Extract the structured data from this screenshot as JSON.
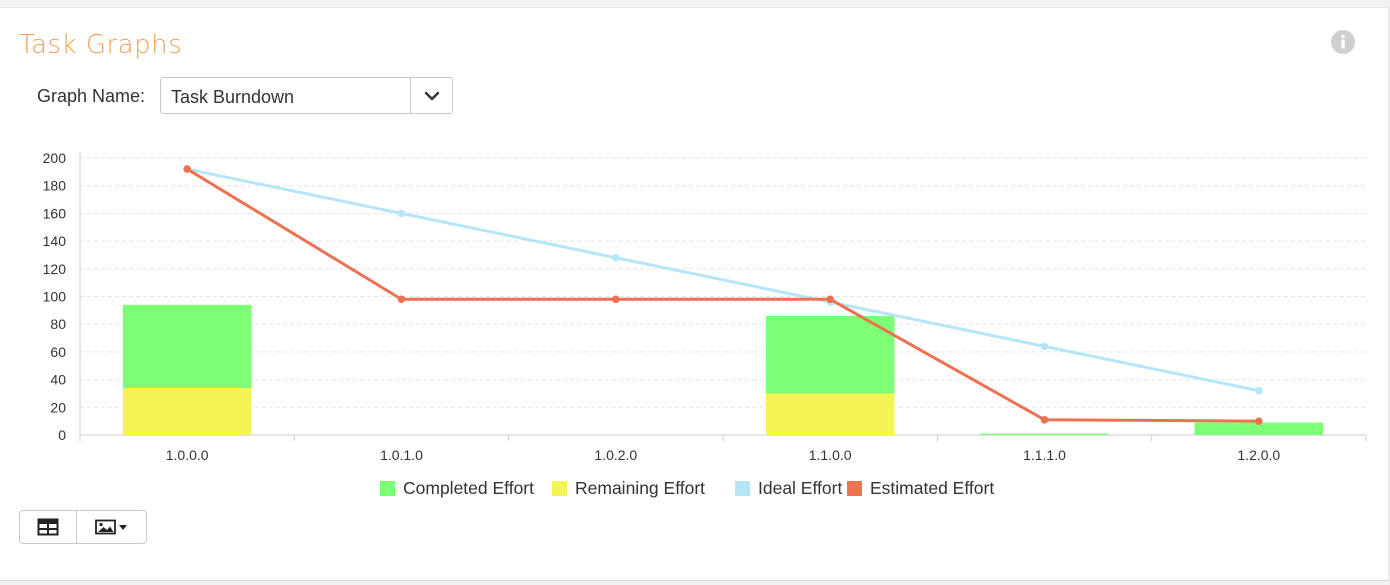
{
  "page": {
    "title": "Task Graphs",
    "graph_name_label": "Graph Name:",
    "graph_name_value": "Task Burndown"
  },
  "icons": {
    "info": "info-circle-icon",
    "dropdown": "chevron-down-icon",
    "table_view": "table-icon",
    "image_export": "image-icon"
  },
  "colors": {
    "title": "#f0a05a",
    "completed": "#7dff76",
    "remaining": "#f4f455",
    "ideal": "#b6e5f8",
    "estimated": "#ef7250"
  },
  "chart_data": {
    "type": "bar",
    "categories": [
      "1.0.0.0",
      "1.0.1.0",
      "1.0.2.0",
      "1.1.0.0",
      "1.1.1.0",
      "1.2.0.0"
    ],
    "ylim": [
      0,
      200
    ],
    "yticks": [
      0,
      20,
      40,
      60,
      80,
      100,
      120,
      140,
      160,
      180,
      200
    ],
    "grid": true,
    "legend_position": "bottom",
    "series": [
      {
        "name": "Completed Effort",
        "type": "bar",
        "stack": "effort",
        "values": [
          60,
          0,
          0,
          56,
          1,
          9
        ]
      },
      {
        "name": "Remaining Effort",
        "type": "bar",
        "stack": "effort",
        "values": [
          34,
          0,
          0,
          30,
          0,
          0
        ]
      },
      {
        "name": "Ideal Effort",
        "type": "line",
        "values": [
          192,
          160,
          128,
          96,
          64,
          32
        ]
      },
      {
        "name": "Estimated Effort",
        "type": "line",
        "values": [
          192,
          98,
          98,
          98,
          11,
          10
        ]
      }
    ]
  }
}
